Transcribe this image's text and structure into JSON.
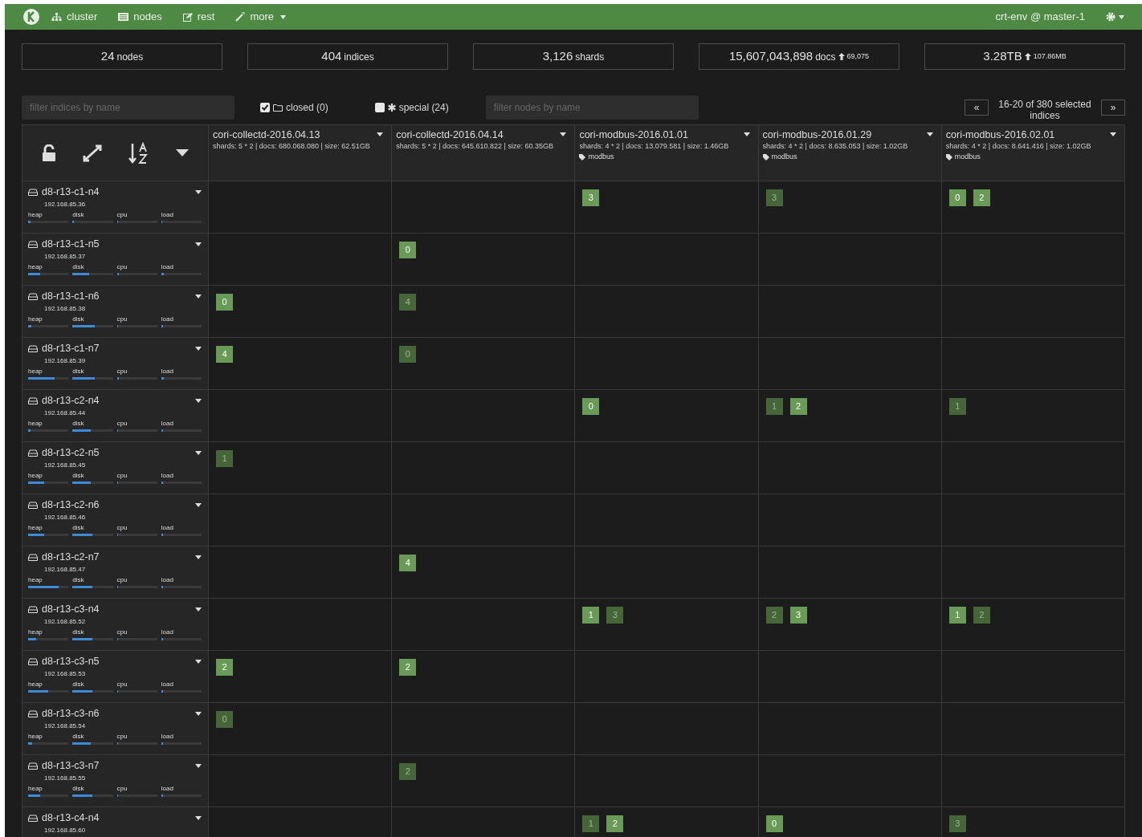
{
  "navbar": {
    "items": [
      {
        "label": "cluster",
        "kind": "cluster"
      },
      {
        "label": "nodes",
        "kind": "nodes"
      },
      {
        "label": "rest",
        "kind": "rest"
      },
      {
        "label": "more",
        "kind": "more"
      }
    ],
    "cluster_name": "crt-env @ master-1"
  },
  "stats": [
    {
      "value": "24",
      "unit": "nodes"
    },
    {
      "value": "404",
      "unit": "indices"
    },
    {
      "value": "3,126",
      "unit": "shards"
    },
    {
      "value": "15,607,043,898",
      "unit": "docs",
      "delta": "69,075"
    },
    {
      "value": "3.28TB",
      "delta": "107.86MB"
    }
  ],
  "filters": {
    "indices_placeholder": "filter indices by name",
    "closed": {
      "label": "closed (0)",
      "checked": true
    },
    "special": {
      "label": "special (24)",
      "checked": false
    },
    "nodes_placeholder": "filter nodes by name",
    "pagination": {
      "prev": "«",
      "label": "16-20 of 380 selected indices",
      "next": "»"
    }
  },
  "indices": [
    {
      "name": "cori-collectd-2016.04.13",
      "info": "shards: 5 * 2 | docs: 680.068.080 | size: 62.51GB"
    },
    {
      "name": "cori-collectd-2016.04.14",
      "info": "shards: 5 * 2 | docs: 645.610.822 | size: 60.35GB"
    },
    {
      "name": "cori-modbus-2016.01.01",
      "info": "shards: 4 * 2 | docs: 13.079.581 | size: 1.46GB",
      "alias": "modbus"
    },
    {
      "name": "cori-modbus-2016.01.29",
      "info": "shards: 4 * 2 | docs: 8.635.053 | size: 1.02GB",
      "alias": "modbus"
    },
    {
      "name": "cori-modbus-2016.02.01",
      "info": "shards: 4 * 2 | docs: 8.641.416 | size: 1.02GB",
      "alias": "modbus"
    }
  ],
  "nodes": [
    {
      "name": "d8-r13-c1-n4",
      "ip": "192.168.85.36",
      "metrics": [
        {
          "label": "heap",
          "level": 0.05
        },
        {
          "label": "disk",
          "level": 0.03
        },
        {
          "label": "cpu",
          "level": 0.02
        },
        {
          "label": "load",
          "level": 0.02
        }
      ],
      "shards": {
        "column_3": [
          {
            "number": "3",
            "primary": true
          }
        ],
        "column_4": [
          {
            "number": "3",
            "primary": false
          }
        ],
        "column_5": [
          {
            "number": "0",
            "primary": true
          },
          {
            "number": "2",
            "primary": true
          }
        ]
      }
    },
    {
      "name": "d8-r13-c1-n5",
      "ip": "192.168.85.37",
      "metrics": [
        {
          "label": "heap",
          "level": 0.3
        },
        {
          "label": "disk",
          "level": 0.42
        },
        {
          "label": "cpu",
          "level": 0.05
        },
        {
          "label": "load",
          "level": 0.07
        }
      ],
      "shards": {
        "column_2": [
          {
            "number": "0",
            "primary": true
          }
        ]
      }
    },
    {
      "name": "d8-r13-c1-n6",
      "ip": "192.168.85.38",
      "metrics": [
        {
          "label": "heap",
          "level": 0.08
        },
        {
          "label": "disk",
          "level": 0.55
        },
        {
          "label": "cpu",
          "level": 0.03
        },
        {
          "label": "load",
          "level": 0.05
        }
      ],
      "shards": {
        "column_1": [
          {
            "number": "0",
            "primary": true
          }
        ],
        "column_2": [
          {
            "number": "4",
            "primary": false
          }
        ]
      }
    },
    {
      "name": "d8-r13-c1-n7",
      "ip": "192.168.85.39",
      "metrics": [
        {
          "label": "heap",
          "level": 0.65
        },
        {
          "label": "disk",
          "level": 0.55
        },
        {
          "label": "cpu",
          "level": 0.04
        },
        {
          "label": "load",
          "level": 0.06
        }
      ],
      "shards": {
        "column_1": [
          {
            "number": "4",
            "primary": true
          }
        ],
        "column_2": [
          {
            "number": "0",
            "primary": false
          }
        ]
      }
    },
    {
      "name": "d8-r13-c2-n4",
      "ip": "192.168.85.44",
      "metrics": [
        {
          "label": "heap",
          "level": 0.05
        },
        {
          "label": "disk",
          "level": 0.45
        },
        {
          "label": "cpu",
          "level": 0.02
        },
        {
          "label": "load",
          "level": 0.05
        }
      ],
      "shards": {
        "column_3": [
          {
            "number": "0",
            "primary": true
          }
        ],
        "column_4": [
          {
            "number": "1",
            "primary": false
          },
          {
            "number": "2",
            "primary": true
          }
        ],
        "column_5": [
          {
            "number": "1",
            "primary": false
          }
        ]
      }
    },
    {
      "name": "d8-r13-c2-n5",
      "ip": "192.168.85.45",
      "metrics": [
        {
          "label": "heap",
          "level": 0.4
        },
        {
          "label": "disk",
          "level": 0.45
        },
        {
          "label": "cpu",
          "level": 0.03
        },
        {
          "label": "load",
          "level": 0.05
        }
      ],
      "shards": {
        "column_1": [
          {
            "number": "1",
            "primary": false
          }
        ]
      }
    },
    {
      "name": "d8-r13-c2-n6",
      "ip": "192.168.85.46",
      "metrics": [
        {
          "label": "heap",
          "level": 0.4
        },
        {
          "label": "disk",
          "level": 0.5
        },
        {
          "label": "cpu",
          "level": 0.03
        },
        {
          "label": "load",
          "level": 0.05
        }
      ]
    },
    {
      "name": "d8-r13-c2-n7",
      "ip": "192.168.85.47",
      "metrics": [
        {
          "label": "heap",
          "level": 0.75
        },
        {
          "label": "disk",
          "level": 0.5
        },
        {
          "label": "cpu",
          "level": 0.03
        },
        {
          "label": "load",
          "level": 0.05
        }
      ],
      "shards": {
        "column_2": [
          {
            "number": "4",
            "primary": true
          }
        ]
      }
    },
    {
      "name": "d8-r13-c3-n4",
      "ip": "192.168.85.52",
      "metrics": [
        {
          "label": "heap",
          "level": 0.2
        },
        {
          "label": "disk",
          "level": 0.5
        },
        {
          "label": "cpu",
          "level": 0.03
        },
        {
          "label": "load",
          "level": 0.05
        }
      ],
      "shards": {
        "column_3": [
          {
            "number": "1",
            "primary": true
          },
          {
            "number": "3",
            "primary": false
          }
        ],
        "column_4": [
          {
            "number": "2",
            "primary": false
          },
          {
            "number": "3",
            "primary": true
          }
        ],
        "column_5": [
          {
            "number": "1",
            "primary": true
          },
          {
            "number": "2",
            "primary": false
          }
        ]
      }
    },
    {
      "name": "d8-r13-c3-n5",
      "ip": "192.168.85.53",
      "metrics": [
        {
          "label": "heap",
          "level": 0.5
        },
        {
          "label": "disk",
          "level": 0.5
        },
        {
          "label": "cpu",
          "level": 0.03
        },
        {
          "label": "load",
          "level": 0.05
        }
      ],
      "shards": {
        "column_1": [
          {
            "number": "2",
            "primary": true
          }
        ],
        "column_2": [
          {
            "number": "2",
            "primary": true
          }
        ]
      }
    },
    {
      "name": "d8-r13-c3-n6",
      "ip": "192.168.85.54",
      "metrics": [
        {
          "label": "heap",
          "level": 0.1
        },
        {
          "label": "disk",
          "level": 0.45
        },
        {
          "label": "cpu",
          "level": 0.03
        },
        {
          "label": "load",
          "level": 0.05
        }
      ],
      "shards": {
        "column_1": [
          {
            "number": "0",
            "primary": false
          }
        ]
      }
    },
    {
      "name": "d8-r13-c3-n7",
      "ip": "192.168.85.55",
      "metrics": [
        {
          "label": "heap",
          "level": 0.3
        },
        {
          "label": "disk",
          "level": 0.5
        },
        {
          "label": "cpu",
          "level": 0.03
        },
        {
          "label": "load",
          "level": 0.05
        }
      ],
      "shards": {
        "column_2": [
          {
            "number": "2",
            "primary": false
          }
        ]
      }
    },
    {
      "name": "d8-r13-c4-n4",
      "ip": "192.168.85.60",
      "shards": {
        "column_3": [
          {
            "number": "1",
            "primary": false
          },
          {
            "number": "2",
            "primary": true
          }
        ],
        "column_4": [
          {
            "number": "0",
            "primary": true
          }
        ],
        "column_5": [
          {
            "number": "3",
            "primary": false
          }
        ]
      }
    }
  ]
}
